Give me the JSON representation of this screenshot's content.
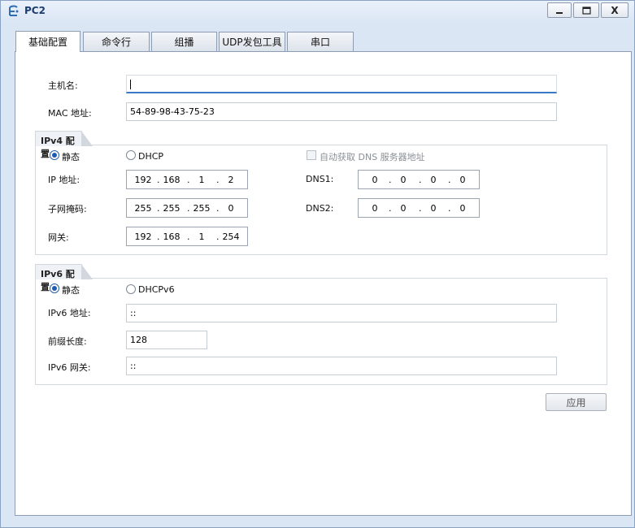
{
  "window": {
    "title": "PC2",
    "close_glyph": "X"
  },
  "tabs": [
    {
      "label": "基础配置",
      "active": true
    },
    {
      "label": "命令行"
    },
    {
      "label": "组播"
    },
    {
      "label": "UDP发包工具"
    },
    {
      "label": "串口"
    }
  ],
  "basic": {
    "hostname_label": "主机名:",
    "hostname_value": "",
    "mac_label": "MAC 地址:",
    "mac_value": "54-89-98-43-75-23"
  },
  "ipv4": {
    "group_title": "IPv4 配置",
    "static_label": "静态",
    "dhcp_label": "DHCP",
    "auto_dns_label": "自动获取 DNS 服务器地址",
    "ip_label": "IP 地址:",
    "ip": [
      "192",
      "168",
      "1",
      "2"
    ],
    "mask_label": "子网掩码:",
    "mask": [
      "255",
      "255",
      "255",
      "0"
    ],
    "gateway_label": "网关:",
    "gateway": [
      "192",
      "168",
      "1",
      "254"
    ],
    "dns1_label": "DNS1:",
    "dns1": [
      "0",
      "0",
      "0",
      "0"
    ],
    "dns2_label": "DNS2:",
    "dns2": [
      "0",
      "0",
      "0",
      "0"
    ]
  },
  "ipv6": {
    "group_title": "IPv6 配置",
    "static_label": "静态",
    "dhcp_label": "DHCPv6",
    "addr_label": "IPv6 地址:",
    "addr_value": "::",
    "prefix_label": "前缀长度:",
    "prefix_value": "128",
    "gateway_label": "IPv6 网关:",
    "gateway_value": "::"
  },
  "apply_label": "应用"
}
